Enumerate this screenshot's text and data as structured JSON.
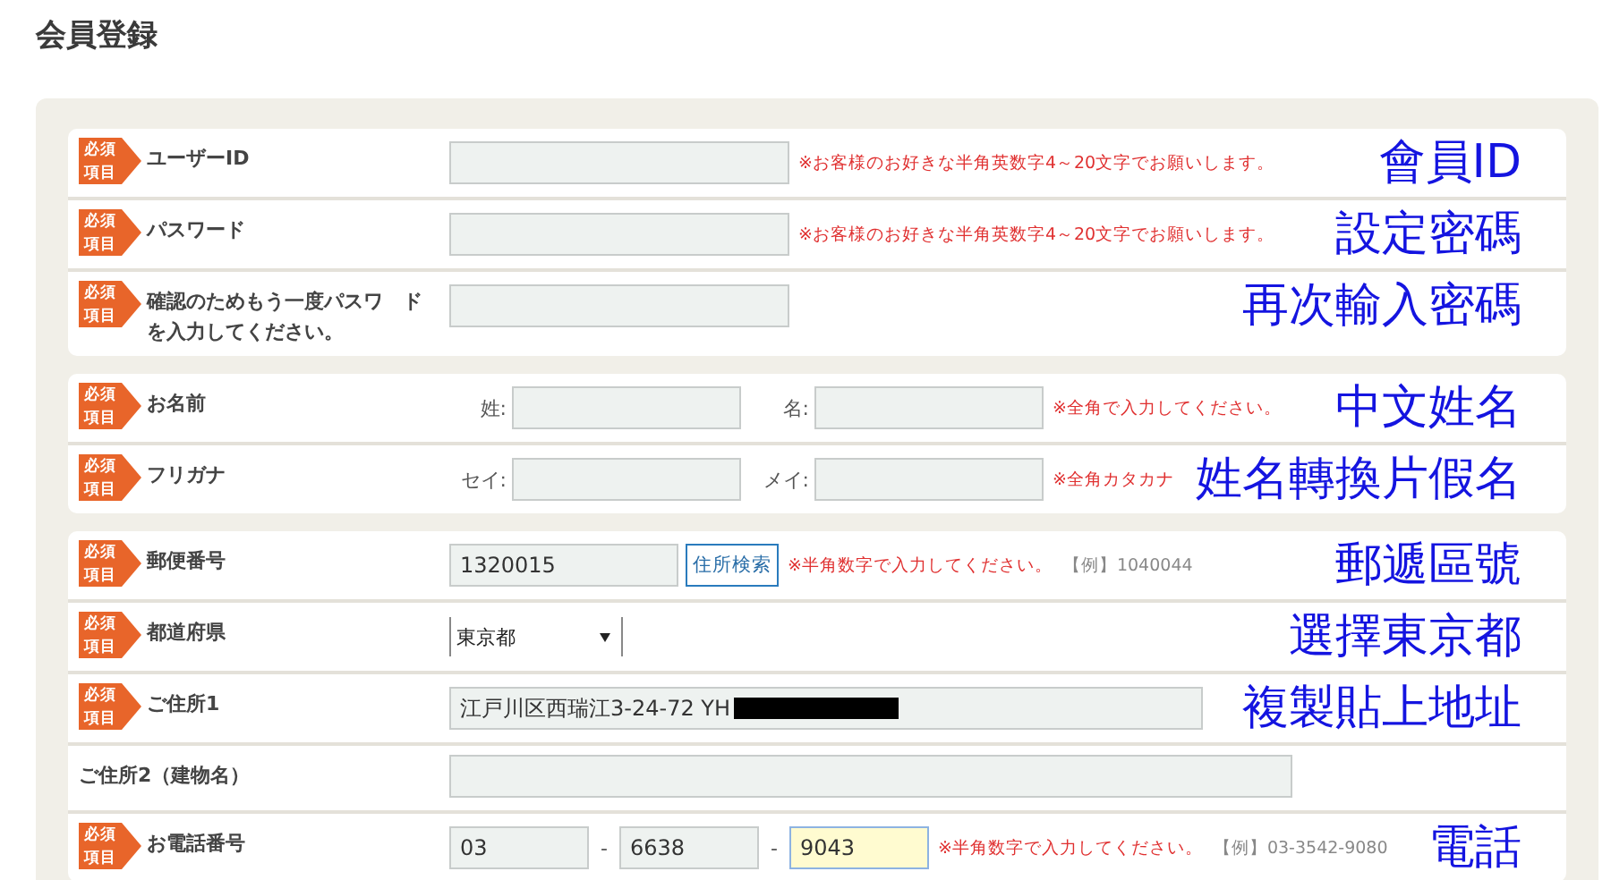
{
  "title": "会員登録",
  "groups": [
    {
      "rows": [
        {
          "kind": "text",
          "badge": "必須項目",
          "label": "ユーザーID",
          "controls": [
            {
              "kind": "input",
              "focused": false
            },
            {
              "kind": "note",
              "text": "※お客様のお好きな半角英数字4～20文字でお願いします。"
            }
          ],
          "annotation": "會員ID"
        },
        {
          "kind": "text",
          "badge": "必須項目",
          "label": "パスワード",
          "controls": [
            {
              "kind": "input",
              "focused": false
            },
            {
              "kind": "note",
              "text": "※お客様のお好きな半角英数字4～20文字でお願いします。"
            }
          ],
          "annotation": "設定密碼"
        },
        {
          "kind": "text",
          "badge": "必須項目",
          "label": "確認のためもう一度パスワ　ドを入力してください。",
          "controls": [
            {
              "kind": "input",
              "focused": false
            }
          ],
          "annotation": "再次輸入密碼"
        }
      ]
    },
    {
      "rows": [
        {
          "kind": "name",
          "badge": "必須項目",
          "label": "お名前",
          "controls": [
            {
              "kind": "field-label",
              "text": "姓:"
            },
            {
              "kind": "input",
              "focused": false
            },
            {
              "kind": "field-label",
              "text": "名:"
            },
            {
              "kind": "input",
              "focused": false
            },
            {
              "kind": "note",
              "text": "※全角で入力してください。"
            }
          ],
          "annotation": "中文姓名"
        },
        {
          "kind": "name",
          "badge": "必須項目",
          "label": "フリガナ",
          "controls": [
            {
              "kind": "field-label",
              "text": "セイ:"
            },
            {
              "kind": "input",
              "focused": false
            },
            {
              "kind": "field-label",
              "text": "メイ:"
            },
            {
              "kind": "input",
              "focused": false
            },
            {
              "kind": "note",
              "text": "※全角カタカナ"
            }
          ],
          "annotation": "姓名轉換片假名"
        }
      ]
    },
    {
      "rows": [
        {
          "kind": "postal",
          "badge": "必須項目",
          "label": "郵便番号",
          "controls": [
            {
              "kind": "input",
              "value": "1320015",
              "focused": false
            },
            {
              "kind": "button",
              "text": "住所検索"
            },
            {
              "kind": "note",
              "text": "※半角数字で入力してください。"
            },
            {
              "kind": "example",
              "text": "【例】1040044"
            }
          ],
          "annotation": "郵遞區號"
        },
        {
          "kind": "select",
          "badge": "必須項目",
          "label": "都道府県",
          "controls": [
            {
              "kind": "select",
              "value": "東京都"
            }
          ],
          "annotation": "選擇東京都"
        },
        {
          "kind": "address",
          "badge": "必須項目",
          "label": "ご住所1",
          "controls": [
            {
              "kind": "input",
              "value": "江戸川区西瑞江3-24-72 YH",
              "redacted": true,
              "focused": false
            }
          ],
          "annotation": "複製貼上地址"
        },
        {
          "kind": "building",
          "label": "ご住所2（建物名）",
          "controls": [
            {
              "kind": "input",
              "focused": false
            }
          ]
        },
        {
          "kind": "phone",
          "badge": "必須項目",
          "label": "お電話番号",
          "controls": [
            {
              "kind": "input",
              "value": "03",
              "focused": false
            },
            {
              "kind": "dash",
              "text": "-"
            },
            {
              "kind": "input",
              "value": "6638",
              "focused": false
            },
            {
              "kind": "dash",
              "text": "-"
            },
            {
              "kind": "input",
              "value": "9043",
              "focused": true
            },
            {
              "kind": "note",
              "text": "※半角数字で入力してください。"
            },
            {
              "kind": "example",
              "text": "【例】03-3542-9080"
            }
          ],
          "annotation": "電話"
        }
      ]
    }
  ]
}
